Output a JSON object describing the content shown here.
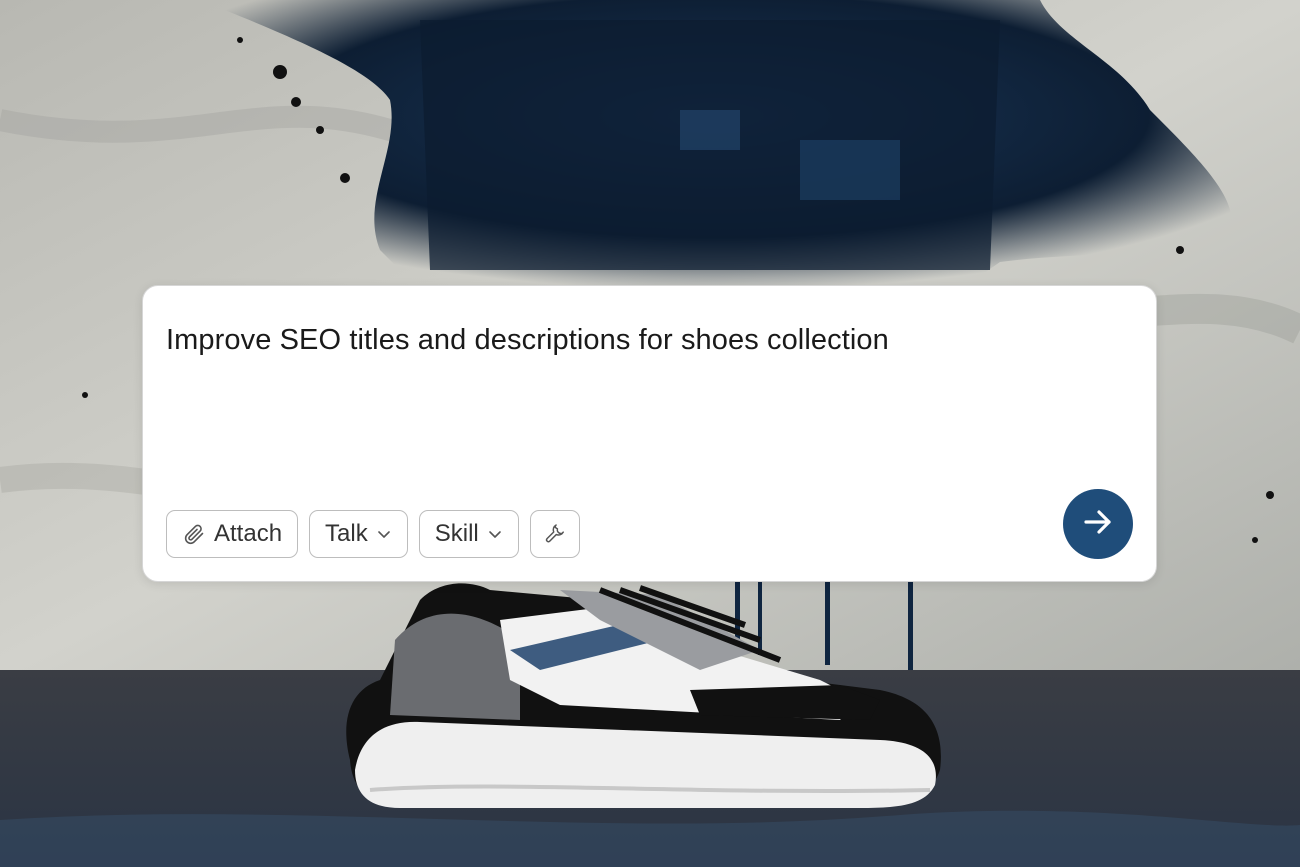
{
  "prompt": {
    "text": "Improve SEO titles and descriptions for shoes collection"
  },
  "toolbar": {
    "attach_label": "Attach",
    "talk_label": "Talk",
    "skill_label": "Skill"
  },
  "icons": {
    "attach": "paperclip-icon",
    "talk_dropdown": "chevron-down-icon",
    "skill_dropdown": "chevron-down-icon",
    "tools": "wrench-icon",
    "send": "arrow-right-icon"
  },
  "colors": {
    "send_button": "#1f4d7a",
    "card_background": "#ffffff",
    "wall": "#c9c9c4",
    "paint_splash": "#0f2540",
    "floor": "#2b2f38"
  }
}
